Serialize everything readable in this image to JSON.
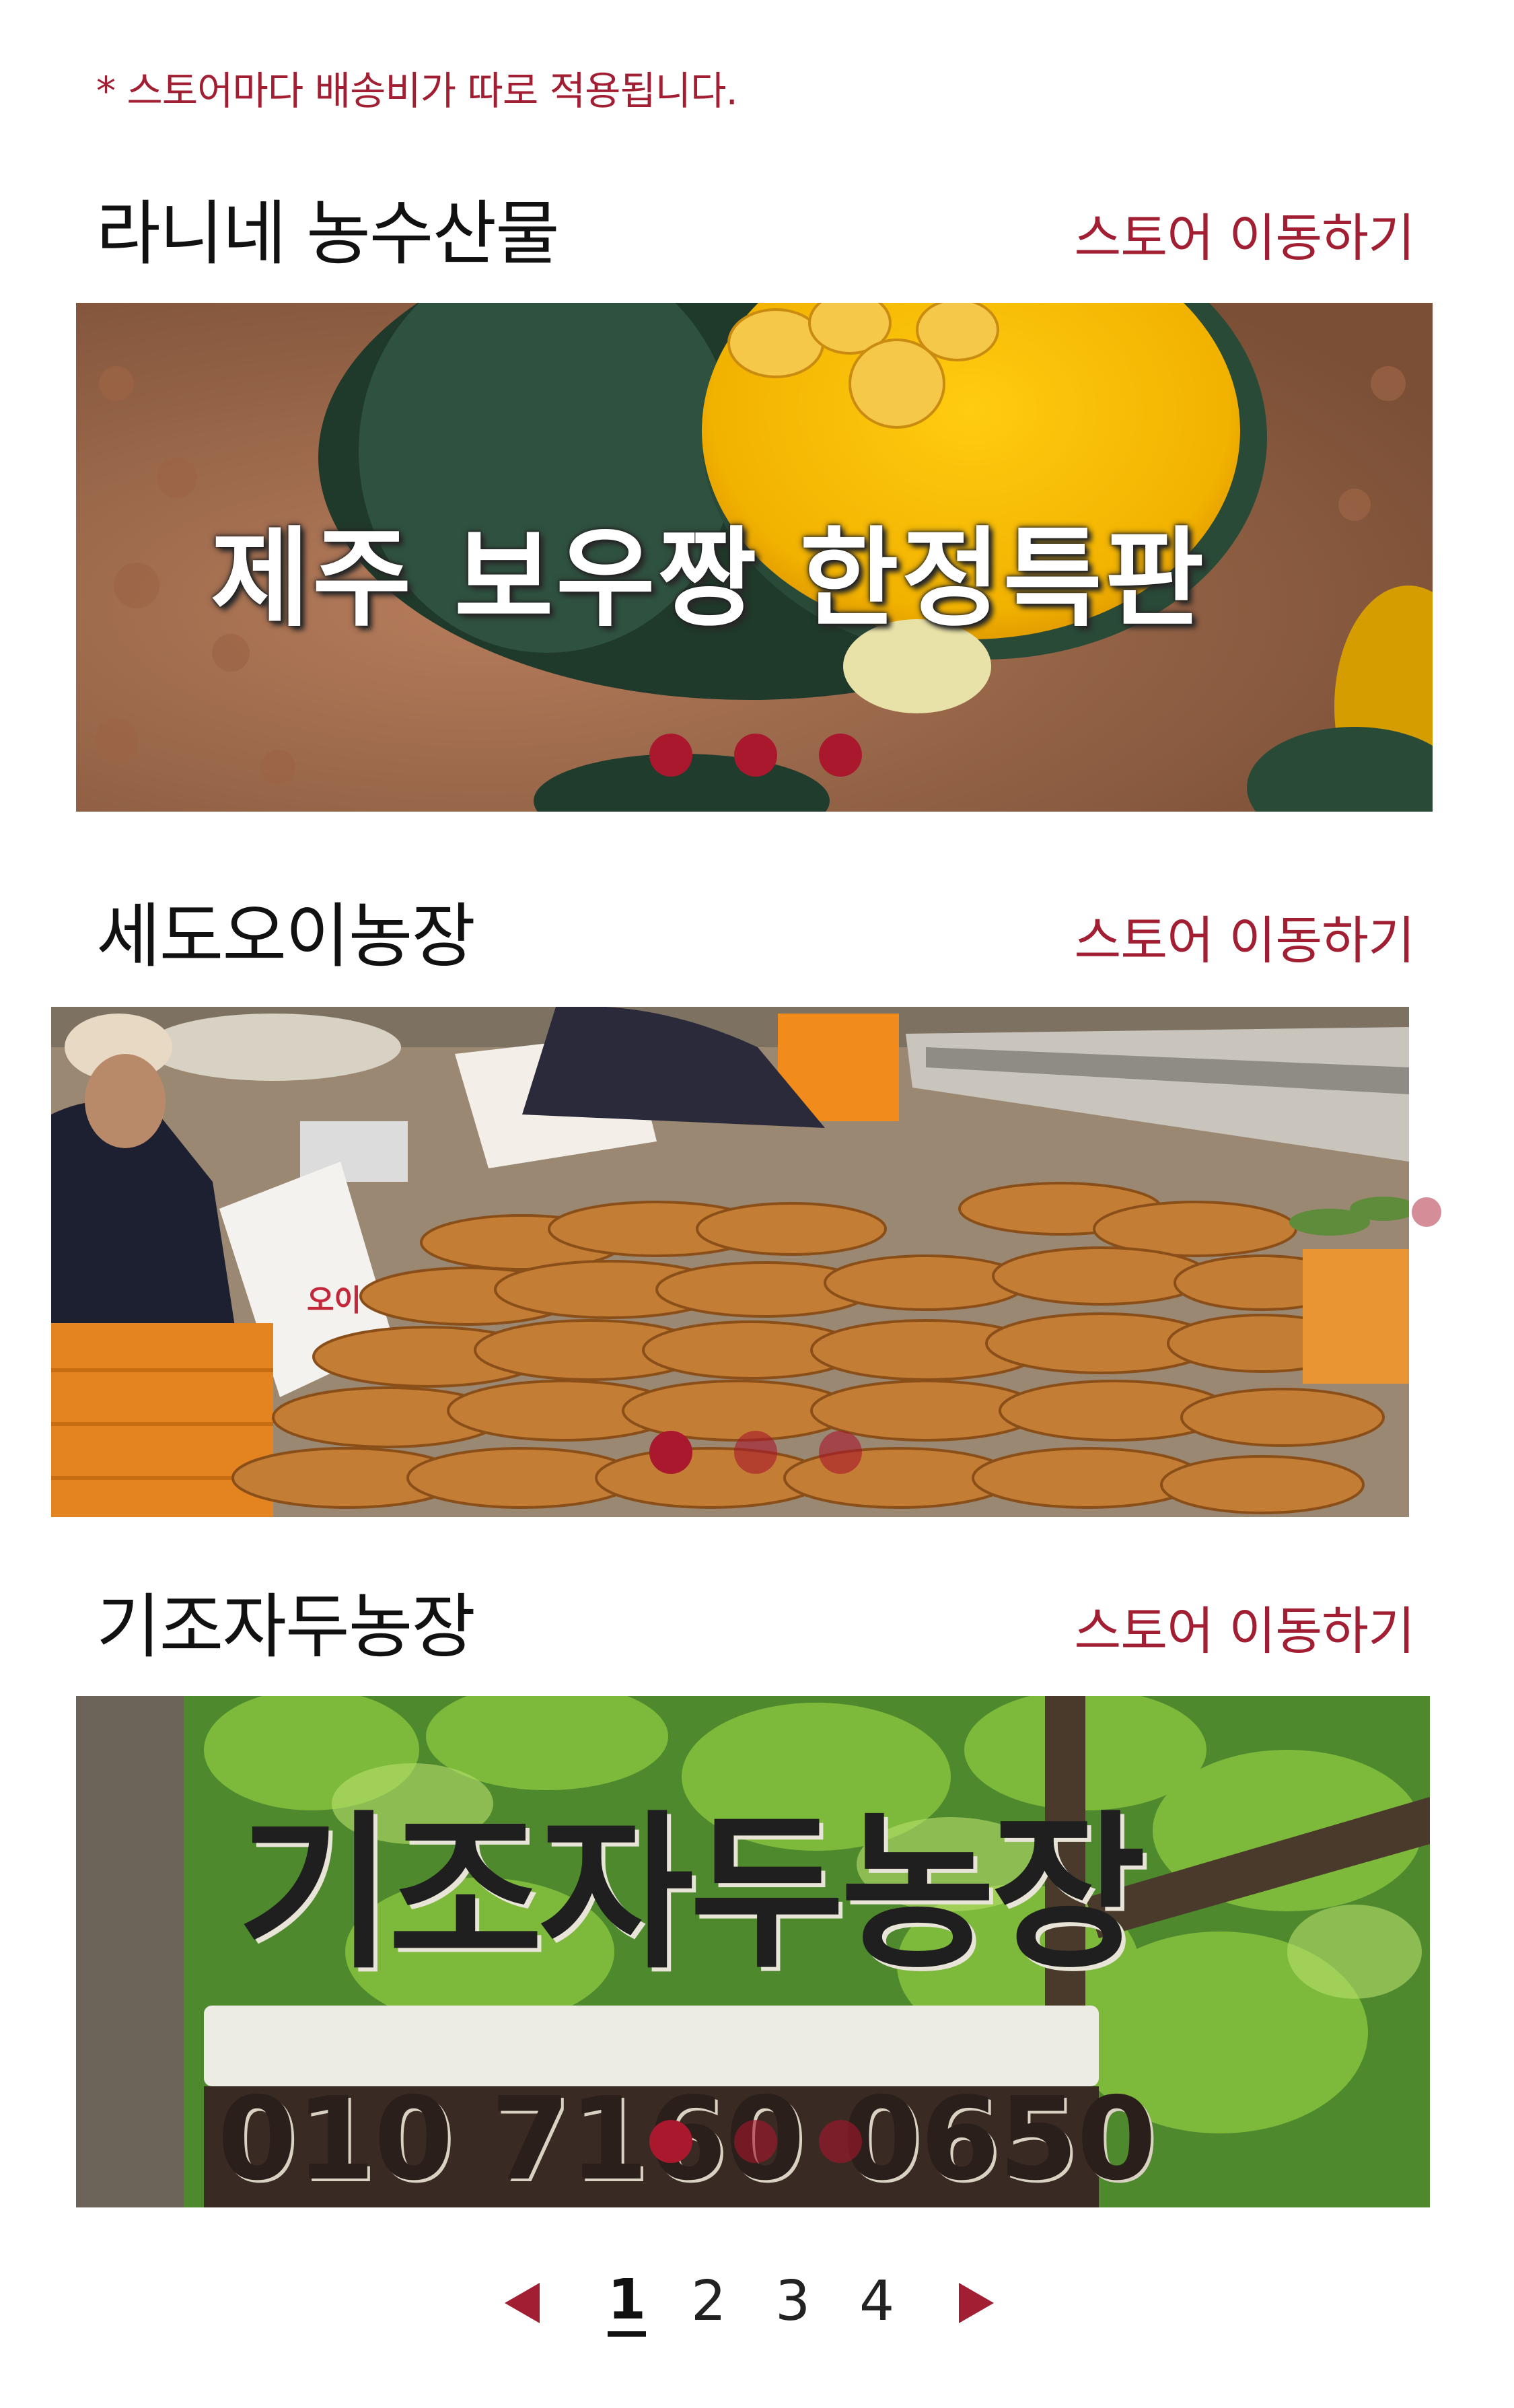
{
  "notice": "* 스토어마다 배송비가 따로 적용됩니다.",
  "stores": [
    {
      "name": "라니네 농수산물",
      "link_label": "스토어 이동하기",
      "banner_text": "제주 보우짱  한정특판"
    },
    {
      "name": "세도오이농장",
      "link_label": "스토어 이동하기",
      "box_label": "오이"
    },
    {
      "name": "기조자두농장",
      "link_label": "스토어 이동하기",
      "sign_text": "기조자두농장",
      "sign_phone": "010 7160 0650"
    }
  ],
  "pagination": {
    "pages": [
      "1",
      "2",
      "3",
      "4"
    ],
    "current": "1"
  },
  "colors": {
    "accent": "#a21f33",
    "dot": "#a9182d"
  },
  "icons": {
    "prev": "triangle-left-icon",
    "next": "triangle-right-icon"
  }
}
